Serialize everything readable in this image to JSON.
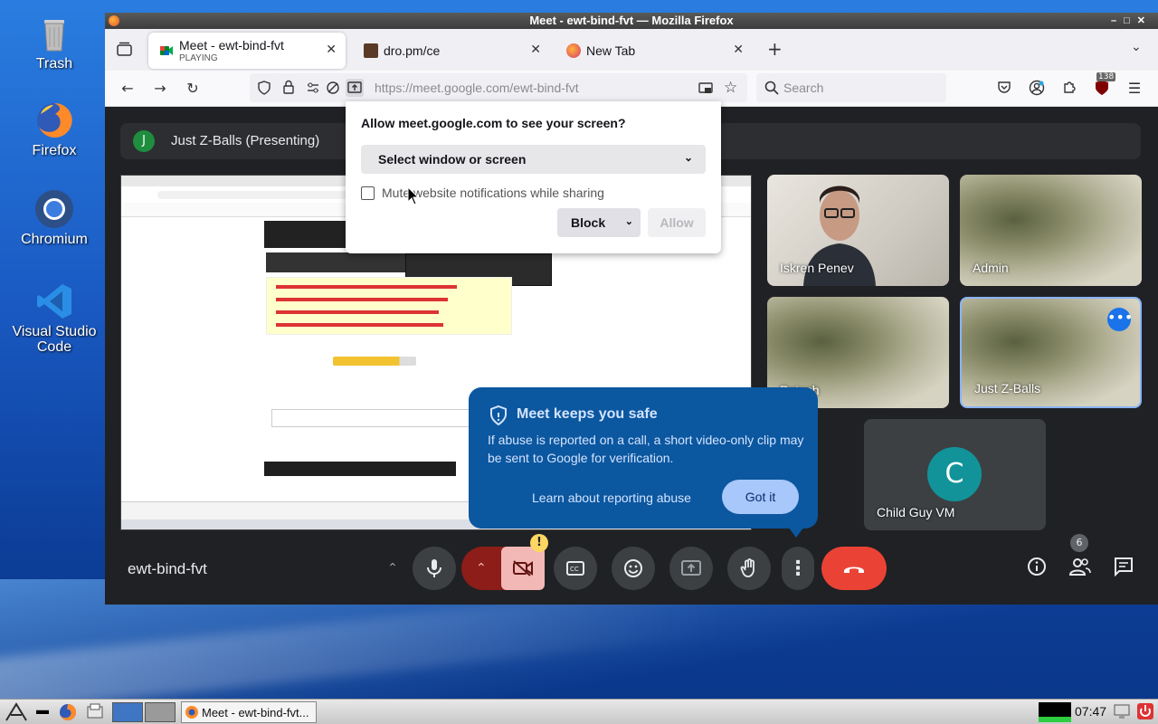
{
  "desktop": {
    "icons": [
      {
        "label": "Trash"
      },
      {
        "label": "Firefox"
      },
      {
        "label": "Chromium"
      },
      {
        "label": "Visual Studio Code"
      }
    ]
  },
  "window": {
    "title": "Meet - ewt-bind-fvt — Mozilla Firefox"
  },
  "tabs": [
    {
      "label": "Meet - ewt-bind-fvt",
      "sub": "PLAYING"
    },
    {
      "label": "dro.pm/ce"
    },
    {
      "label": "New Tab"
    }
  ],
  "navbar": {
    "url_host": "https://meet.google.com",
    "url_path": "/ewt-bind-fvt",
    "search_placeholder": "Search",
    "badge_count": "138"
  },
  "permission": {
    "question": "Allow meet.google.com to see your screen?",
    "select_label": "Select window or screen",
    "mute_label": "Mute website notifications while sharing",
    "block_label": "Block",
    "allow_label": "Allow"
  },
  "meet": {
    "presenting_initial": "J",
    "presenting_text": "Just Z-Balls (Presenting)",
    "meeting_code": "ewt-bind-fvt",
    "participants_count": "6",
    "tiles": [
      {
        "name": "Iskren Penev"
      },
      {
        "name": "Admin"
      },
      {
        "name": "Petesh"
      },
      {
        "name": "Just Z-Balls"
      },
      {
        "name": "Child Guy VM",
        "initial": "C"
      }
    ]
  },
  "safe_tip": {
    "heading": "Meet keeps you safe",
    "body": "If abuse is reported on a call, a short video-only clip may be sent to Google for verification.",
    "learn": "Learn about reporting abuse",
    "got_it": "Got it"
  },
  "taskbar": {
    "window_label": "Meet - ewt-bind-fvt...",
    "time": "07:47"
  }
}
